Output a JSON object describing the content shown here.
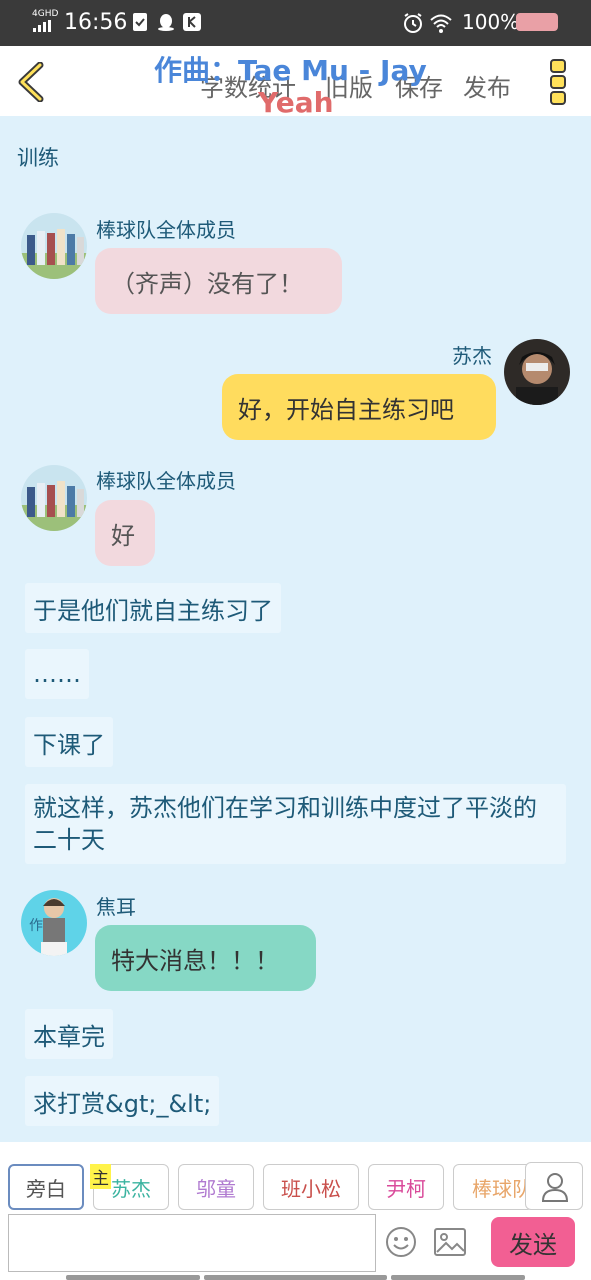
{
  "status_bar": {
    "network": "4GHD",
    "time": "16:56",
    "battery": "100%",
    "icons": [
      "signal-icon",
      "check-icon",
      "qq-icon",
      "k-icon",
      "alarm-icon",
      "wifi-icon",
      "battery-icon"
    ]
  },
  "header": {
    "menu": [
      "字数统计",
      "旧版",
      "保存",
      "发布"
    ],
    "overlay_title": "作曲：Tae Mu - Jay",
    "overlay_sub": "Yeah"
  },
  "chat": {
    "section_label": "训练",
    "messages": [
      {
        "sender": "棒球队全体成员",
        "text": "（齐声）没有了！"
      },
      {
        "sender": "苏杰",
        "text": "好，开始自主练习吧"
      },
      {
        "sender": "棒球队全体成员",
        "text": "好"
      },
      {
        "narration": "于是他们就自主练习了"
      },
      {
        "narration": "……"
      },
      {
        "narration": "下课了"
      },
      {
        "narration": "就这样，苏杰他们在学习和训练中度过了平淡的二十天"
      },
      {
        "sender": "焦耳",
        "text": "特大消息！！！"
      },
      {
        "narration": "本章完"
      },
      {
        "narration": "求打赏&gt;_&lt;"
      }
    ]
  },
  "characters": {
    "chips": [
      "旁白",
      "苏杰",
      "邬童",
      "班小松",
      "尹柯",
      "棒球队"
    ],
    "main_badge": "主"
  },
  "composer": {
    "placeholder": "",
    "send_label": "发送"
  },
  "colors": {
    "background": "#dff1fb",
    "send": "#f25f93",
    "bubble_pink": "#f2d9de",
    "bubble_yellow": "#ffdc5e",
    "bubble_teal": "#86d8c5"
  }
}
